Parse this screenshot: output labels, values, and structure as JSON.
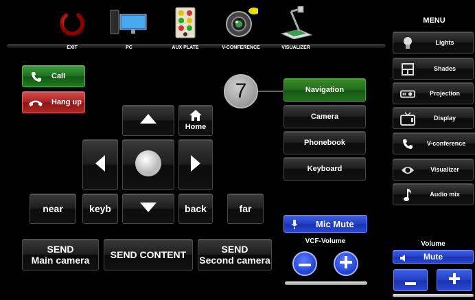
{
  "sources": [
    {
      "label": "EXIT",
      "icon": "power-icon"
    },
    {
      "label": "PC",
      "icon": "pc-monitor-icon"
    },
    {
      "label": "AUX PLATE",
      "icon": "aux-plate-icon"
    },
    {
      "label": "V-CONFERENCE",
      "icon": "webcam-icon"
    },
    {
      "label": "VISUALIZER",
      "icon": "document-camera-icon"
    }
  ],
  "call": {
    "call_label": "Call",
    "hangup_label": "Hang up"
  },
  "dpad": {
    "home_label": "Home"
  },
  "bottom_keys": {
    "near": "near",
    "keyb": "keyb",
    "back": "back",
    "far": "far"
  },
  "send": {
    "main": [
      "SEND",
      "Main camera"
    ],
    "content": "SEND CONTENT",
    "second": [
      "SEND",
      "Second camera"
    ]
  },
  "badge": "7",
  "vcf_menu": {
    "items": [
      "Navigation",
      "Camera",
      "Phonebook",
      "Keyboard"
    ],
    "selected": "Navigation"
  },
  "mic_mute": "Mic Mute",
  "vcf_volume": {
    "label": "VCF-Volume",
    "minus": "−",
    "plus": "+"
  },
  "menu": {
    "title": "MENU",
    "items": [
      {
        "label": "Lights",
        "icon": "lightbulb-icon"
      },
      {
        "label": "Shades",
        "icon": "window-icon"
      },
      {
        "label": "Projection",
        "icon": "projector-icon"
      },
      {
        "label": "Display",
        "icon": "tv-icon"
      },
      {
        "label": "V-conference",
        "icon": "phone-icon"
      },
      {
        "label": "Visualizer",
        "icon": "eye-icon"
      },
      {
        "label": "Audio mix",
        "icon": "music-note-icon"
      }
    ]
  },
  "room_volume": {
    "label": "Volume",
    "mute": "Mute",
    "minus": "−",
    "plus": "+"
  },
  "colors": {
    "green": "#1f6e1f",
    "red": "#a82222",
    "blue": "#2340c8"
  }
}
